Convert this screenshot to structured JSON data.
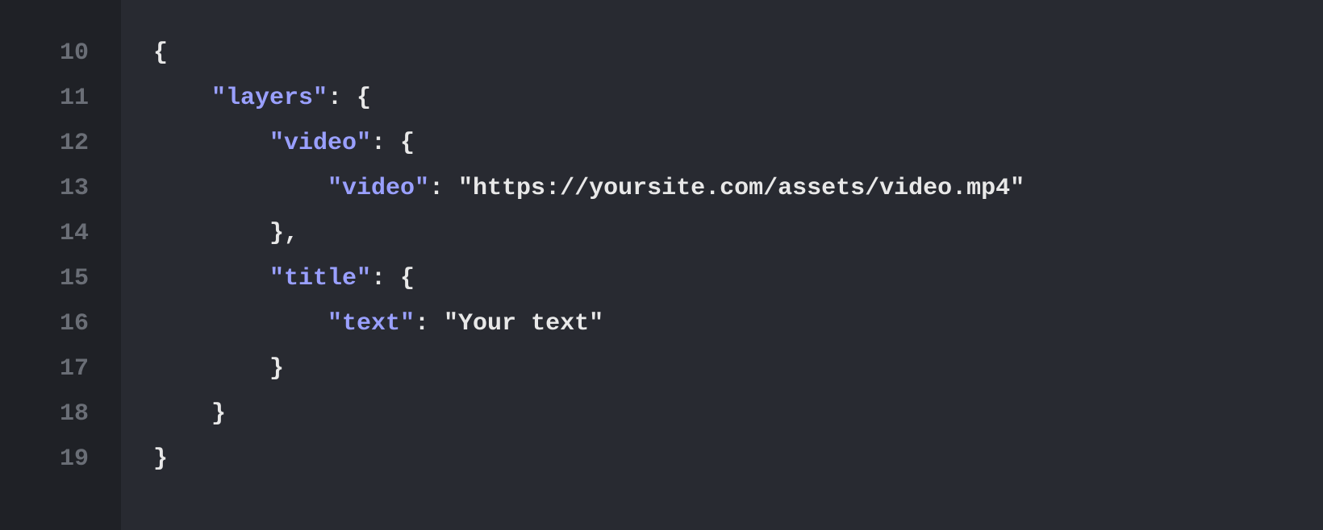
{
  "lines": [
    {
      "number": "10",
      "indent": 1,
      "tokens": [
        {
          "t": "punct",
          "v": "{"
        }
      ]
    },
    {
      "number": "11",
      "indent": 2,
      "tokens": [
        {
          "t": "key",
          "v": "\"layers\""
        },
        {
          "t": "punct",
          "v": ": {"
        }
      ]
    },
    {
      "number": "12",
      "indent": 3,
      "tokens": [
        {
          "t": "key",
          "v": "\"video\""
        },
        {
          "t": "punct",
          "v": ": {"
        }
      ]
    },
    {
      "number": "13",
      "indent": 4,
      "tokens": [
        {
          "t": "key",
          "v": "\"video\""
        },
        {
          "t": "punct",
          "v": ": "
        },
        {
          "t": "str",
          "v": "\"https://yoursite.com/assets/video.mp4\""
        }
      ]
    },
    {
      "number": "14",
      "indent": 3,
      "tokens": [
        {
          "t": "punct",
          "v": "},"
        }
      ]
    },
    {
      "number": "15",
      "indent": 3,
      "tokens": [
        {
          "t": "key",
          "v": "\"title\""
        },
        {
          "t": "punct",
          "v": ": {"
        }
      ]
    },
    {
      "number": "16",
      "indent": 4,
      "tokens": [
        {
          "t": "key",
          "v": "\"text\""
        },
        {
          "t": "punct",
          "v": ": "
        },
        {
          "t": "str",
          "v": "\"Your text\""
        }
      ]
    },
    {
      "number": "17",
      "indent": 3,
      "tokens": [
        {
          "t": "punct",
          "v": "}"
        }
      ]
    },
    {
      "number": "18",
      "indent": 2,
      "tokens": [
        {
          "t": "punct",
          "v": "}"
        }
      ]
    },
    {
      "number": "19",
      "indent": 1,
      "tokens": [
        {
          "t": "punct",
          "v": "}"
        }
      ]
    }
  ]
}
